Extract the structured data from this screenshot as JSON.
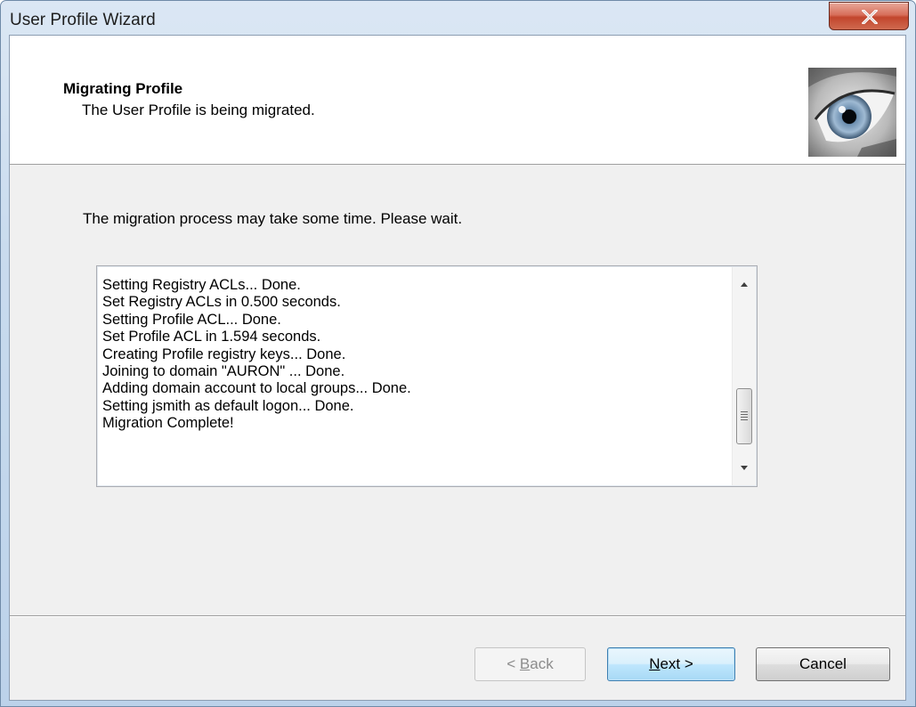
{
  "window": {
    "title": "User Profile Wizard"
  },
  "header": {
    "title": "Migrating Profile",
    "subtitle": "The User Profile is being migrated."
  },
  "instruction": "The migration process may take some time. Please wait.",
  "log": {
    "lines": [
      "Setting Registry ACLs... Done.",
      "Set Registry ACLs in 0.500 seconds.",
      "Setting Profile ACL... Done.",
      "Set Profile ACL in 1.594 seconds.",
      "Creating Profile registry keys... Done.",
      "Joining to domain \"AURON\" ... Done.",
      "Adding domain account to local groups... Done.",
      "Setting jsmith as default logon... Done.",
      "Migration Complete!"
    ],
    "scroll_position": 1.0
  },
  "buttons": {
    "back": {
      "prefix": "< ",
      "mnemonic": "B",
      "rest": "ack",
      "enabled": false
    },
    "next": {
      "mnemonic": "N",
      "rest": "ext >",
      "enabled": true,
      "default": true
    },
    "cancel": {
      "label": "Cancel",
      "enabled": true
    }
  },
  "icons": {
    "close": "close-icon",
    "header_image": "eye-image-icon",
    "scroll_up": "scroll-up-arrow-icon",
    "scroll_down": "scroll-down-arrow-icon"
  },
  "colors": {
    "title_bar": "#c9dbee",
    "close_button": "#c2462d",
    "header_background": "#ffffff",
    "client_background": "#f0f0f0",
    "default_button_border": "#3c7fb1"
  }
}
